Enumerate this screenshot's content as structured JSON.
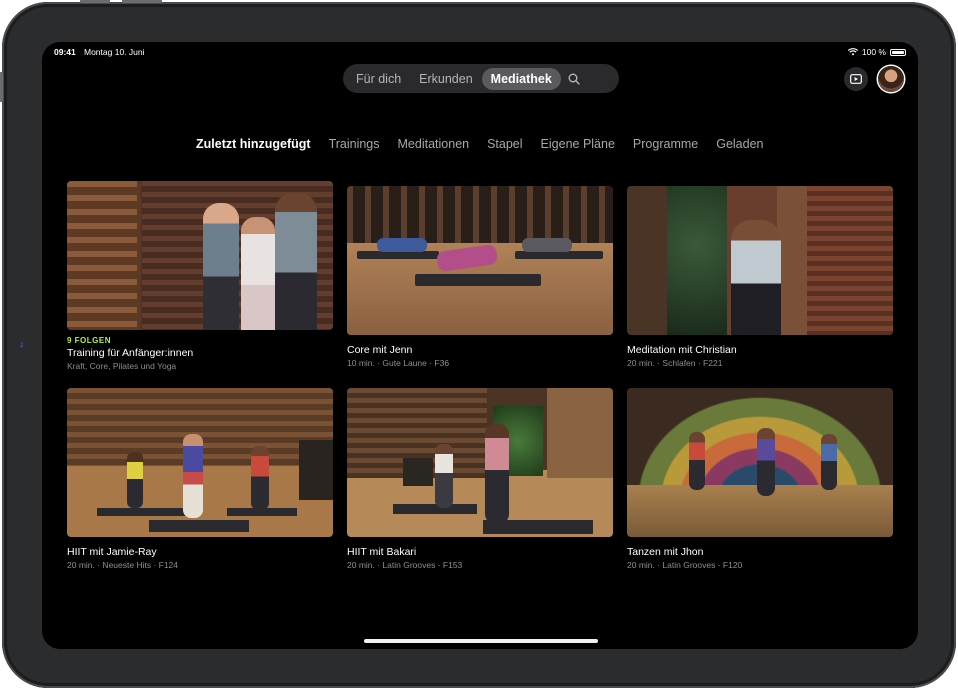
{
  "status_bar": {
    "time": "09:41",
    "date": "Montag 10. Juni",
    "battery": "100 %"
  },
  "top_tabs": [
    {
      "label": "Für dich",
      "active": false
    },
    {
      "label": "Erkunden",
      "active": false
    },
    {
      "label": "Mediathek",
      "active": true
    }
  ],
  "filters": [
    {
      "label": "Zuletzt hinzugefügt",
      "active": true
    },
    {
      "label": "Trainings",
      "active": false
    },
    {
      "label": "Meditationen",
      "active": false
    },
    {
      "label": "Stapel",
      "active": false
    },
    {
      "label": "Eigene Pläne",
      "active": false
    },
    {
      "label": "Programme",
      "active": false
    },
    {
      "label": "Geladen",
      "active": false
    }
  ],
  "cards": [
    {
      "eyebrow": "9 FOLGEN",
      "title": "Training für Anfänger:innen",
      "subtitle": "Kraft, Core, Pilates und Yoga"
    },
    {
      "title": "Core mit Jenn",
      "subtitle": "10 min. · Gute Laune · F36"
    },
    {
      "title": "Meditation mit Christian",
      "subtitle": "20 min. · Schlafen · F221"
    },
    {
      "title": "HIIT mit Jamie-Ray",
      "subtitle": "20 min. · Neueste Hits · F124"
    },
    {
      "title": "HIIT mit Bakari",
      "subtitle": "20 min. · Latin Grooves · F153"
    },
    {
      "title": "Tanzen mit Jhon",
      "subtitle": "20 min. · Latin Grooves · F120"
    }
  ],
  "side_marker": "2",
  "colors": {
    "accent": "#b5f23a",
    "background": "#000000",
    "pill": "#2a2a2c"
  }
}
